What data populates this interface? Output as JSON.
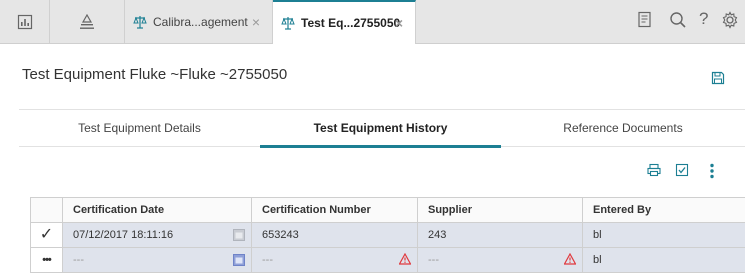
{
  "tabbar": {
    "tabs": [
      {
        "label": "Calibra...agement",
        "close": "×"
      },
      {
        "label": "Test Eq...2755050",
        "close": "×"
      }
    ],
    "icons": [
      "dashboard-icon",
      "hierarchy-icon",
      "document-list-icon",
      "search-icon",
      "help-icon",
      "gear-icon"
    ],
    "help_label": "?"
  },
  "page": {
    "title": "Test Equipment Fluke ~Fluke ~2755050"
  },
  "subtabs": [
    {
      "label": "Test Equipment Details"
    },
    {
      "label": "Test Equipment History"
    },
    {
      "label": "Reference Documents"
    }
  ],
  "grid": {
    "columns": [
      "",
      "Certification Date",
      "Certification Number",
      "Supplier",
      "Entered By"
    ],
    "rows": [
      {
        "marker": "✓",
        "date": "07/12/2017 18:11:16",
        "number": "653243",
        "supplier": "243",
        "entered_by": "bl"
      },
      {
        "marker": "•••",
        "date": "---",
        "number": "---",
        "supplier": "---",
        "entered_by": "bl"
      }
    ]
  },
  "colors": {
    "accent": "#1c7f93",
    "warning": "#e0393e",
    "row_highlight": "#dfe3ec"
  }
}
